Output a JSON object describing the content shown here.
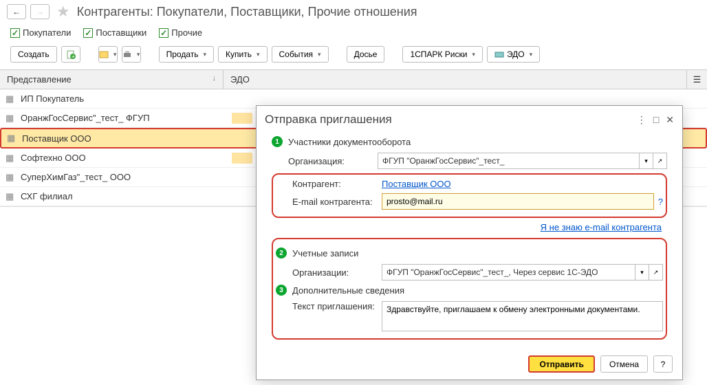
{
  "header": {
    "title": "Контрагенты: Покупатели, Поставщики, Прочие отношения"
  },
  "filters": {
    "buyers": "Покупатели",
    "suppliers": "Поставщики",
    "others": "Прочие"
  },
  "toolbar": {
    "create": "Создать",
    "sell": "Продать",
    "buy": "Купить",
    "events": "События",
    "dossier": "Досье",
    "spark": "1СПАРК Риски",
    "edo": "ЭДО"
  },
  "columns": {
    "name": "Представление",
    "edo": "ЭДО"
  },
  "rows": [
    "ИП Покупатель",
    "ОранжГосСервис\"_тест_ ФГУП",
    "Поставщик ООО",
    "Софтехно ООО",
    "СуперХимГаз\"_тест_ ООО",
    "СХГ филиал"
  ],
  "dialog": {
    "title": "Отправка приглашения",
    "step1": "Участники документооборота",
    "org_label": "Организация:",
    "org_value": "ФГУП \"ОранжГосСервис\"_тест_",
    "counter_label": "Контрагент:",
    "counter_value": "Поставщик ООО",
    "email_label": "E-mail контрагента:",
    "email_value": "prosto@mail.ru",
    "unknown_email": "Я не знаю e-mail контрагента",
    "step2": "Учетные записи",
    "org2_label": "Организации:",
    "org2_value": "ФГУП \"ОранжГосСервис\"_тест_, Через сервис 1С-ЭДО",
    "step3": "Дополнительные сведения",
    "invite_label": "Текст приглашения:",
    "invite_value": "Здравствуйте, приглашаем к обмену электронными документами.",
    "send": "Отправить",
    "cancel": "Отмена",
    "help": "?"
  }
}
